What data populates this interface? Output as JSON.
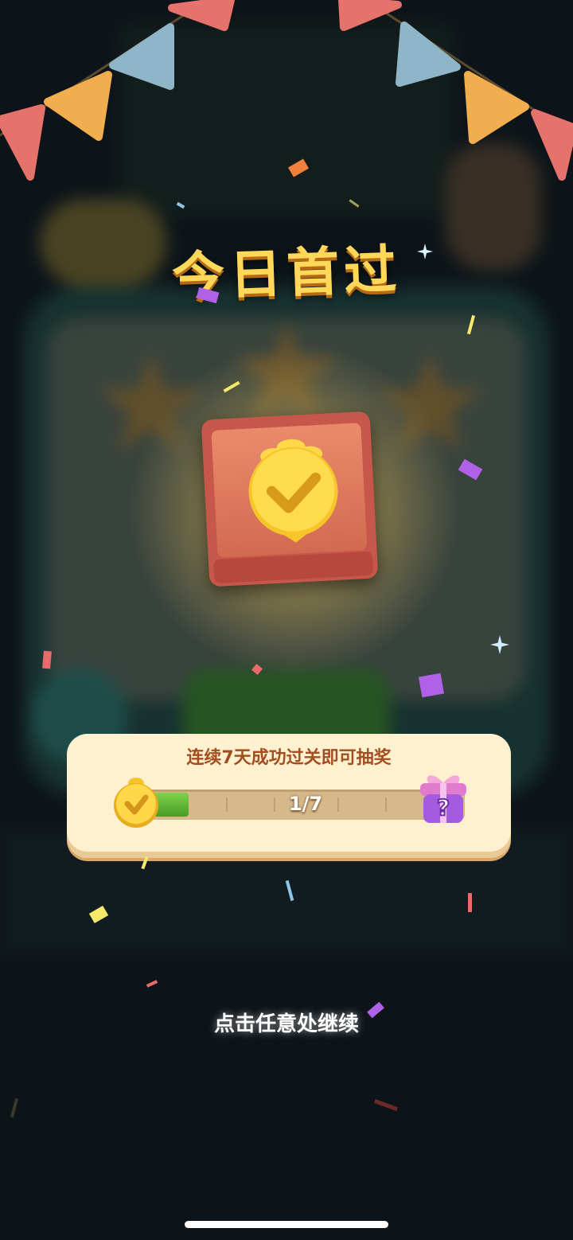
{
  "title": "今日首过",
  "streak": {
    "text": "连续7天成功过关即可抽奖",
    "current": 1,
    "total": 7,
    "progress_label": "1/7",
    "progress_fraction": 0.142857
  },
  "continue_hint": "点击任意处继续",
  "colors": {
    "title": "#ffd85a",
    "banner_bg": "#fff1cf",
    "banner_text": "#a24e20",
    "progress_fill": "#5fb533",
    "card": "#d26a52",
    "background": "#0d1419"
  },
  "icons": {
    "reward": "gold-chick-medal-icon",
    "start": "gold-coin-check-icon",
    "end": "mystery-gift-box-icon"
  }
}
